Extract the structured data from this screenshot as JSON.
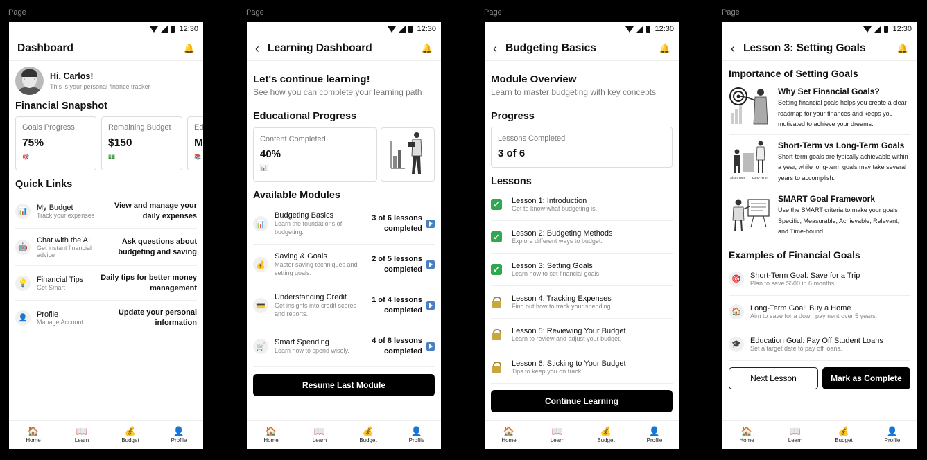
{
  "page_label": "Page",
  "status_time": "12:30",
  "bottom_nav": [
    {
      "icon": "🏠",
      "label": "Home"
    },
    {
      "icon": "📖",
      "label": "Learn"
    },
    {
      "icon": "💰",
      "label": "Budget"
    },
    {
      "icon": "👤",
      "label": "Profile"
    }
  ],
  "screen1": {
    "title": "Dashboard",
    "greeting": "Hi, Carlos!",
    "greeting_sub": "This is your personal finance tracker",
    "snapshot_title": "Financial Snapshot",
    "cards": [
      {
        "label": "Goals Progress",
        "value": "75%",
        "icon": "🎯"
      },
      {
        "label": "Remaining Budget",
        "value": "$150",
        "icon": "💵"
      },
      {
        "label": "Edu",
        "value": "Mo",
        "icon": "📚"
      }
    ],
    "quick_links_title": "Quick Links",
    "quick_links": [
      {
        "icon": "📊",
        "name": "My Budget",
        "desc": "Track your expenses",
        "desc_line2": "",
        "right": "View and manage your daily expenses"
      },
      {
        "icon": "🤖",
        "name": "Chat with the AI",
        "desc": "Get instant financial",
        "desc_line2": "advice",
        "right": "Ask questions about budgeting and saving"
      },
      {
        "icon": "💡",
        "name": "Financial Tips",
        "desc": "Get Smart",
        "desc_line2": "",
        "right": "Daily tips for better money management"
      },
      {
        "icon": "👤",
        "name": "Profile",
        "desc": "Manage Account",
        "desc_line2": "",
        "right": "Update your personal information"
      }
    ]
  },
  "screen2": {
    "title": "Learning Dashboard",
    "heading": "Let's continue learning!",
    "subheading": "See how you can complete your learning path",
    "progress_title": "Educational Progress",
    "progress_label": "Content Completed",
    "progress_value": "40%",
    "progress_icon": "📊",
    "modules_title": "Available Modules",
    "modules": [
      {
        "icon": "📊",
        "name": "Budgeting Basics",
        "desc": "Learn the foundations of budgeting.",
        "right": "3 of 6 lessons completed"
      },
      {
        "icon": "💰",
        "name": "Saving & Goals",
        "desc": "Master saving techniques and setting goals.",
        "right": "2 of 5 lessons completed"
      },
      {
        "icon": "💳",
        "name": "Understanding Credit",
        "desc": "Get insights into credit scores and reports.",
        "right": "1 of 4 lessons completed"
      },
      {
        "icon": "🛒",
        "name": "Smart Spending",
        "desc": "Learn how to spend wisely.",
        "right": "4 of 8 lessons completed"
      }
    ],
    "resume_button": "Resume Last Module"
  },
  "screen3": {
    "title": "Budgeting Basics",
    "overview_title": "Module Overview",
    "overview_sub": "Learn to master budgeting with key concepts",
    "progress_title": "Progress",
    "progress_label": "Lessons Completed",
    "progress_value": "3 of 6",
    "lessons_title": "Lessons",
    "lessons": [
      {
        "name": "Lesson 1: Introduction",
        "desc": "Get to know what budgeting is.",
        "done": true
      },
      {
        "name": "Lesson 2: Budgeting Methods",
        "desc": "Explore different ways to budget.",
        "done": true
      },
      {
        "name": "Lesson 3: Setting Goals",
        "desc": "Learn how to set financial goals.",
        "done": true
      },
      {
        "name": "Lesson 4: Tracking Expenses",
        "desc": "Find out how to track your spending.",
        "done": false
      },
      {
        "name": "Lesson 5: Reviewing Your Budget",
        "desc": "Learn to review and adjust your budget.",
        "done": false
      },
      {
        "name": "Lesson 6: Sticking to Your Budget",
        "desc": "Tips to keep you on track.",
        "done": false
      }
    ],
    "continue_button": "Continue Learning"
  },
  "screen4": {
    "title": "Lesson 3: Setting Goals",
    "importance_title": "Importance of Setting Goals",
    "importance": [
      {
        "name": "Why Set Financial Goals?",
        "desc": "Setting financial goals helps you create a clear roadmap for your finances and keeps you motivated to achieve your dreams."
      },
      {
        "name": "Short-Term vs Long-Term Goals",
        "desc": "Short-term goals are typically achievable within a year, while long-term goals may take several years to accomplish."
      },
      {
        "name": "SMART Goal Framework",
        "desc": "Use the SMART criteria to make your goals Specific, Measurable, Achievable, Relevant, and Time-bound."
      }
    ],
    "chart_labels": {
      "short": "Short-Term",
      "long": "Long-Term"
    },
    "examples_title": "Examples of Financial Goals",
    "examples": [
      {
        "icon": "🎯",
        "name": "Short-Term Goal: Save for a Trip",
        "desc": "Plan to save $500 in 6 months."
      },
      {
        "icon": "🏠",
        "name": "Long-Term Goal: Buy a Home",
        "desc": "Aim to save for a down payment over 5 years."
      },
      {
        "icon": "🎓",
        "name": "Education Goal: Pay Off Student Loans",
        "desc": "Set a target date to pay off loans."
      }
    ],
    "next_button": "Next Lesson",
    "complete_button": "Mark as Complete"
  }
}
